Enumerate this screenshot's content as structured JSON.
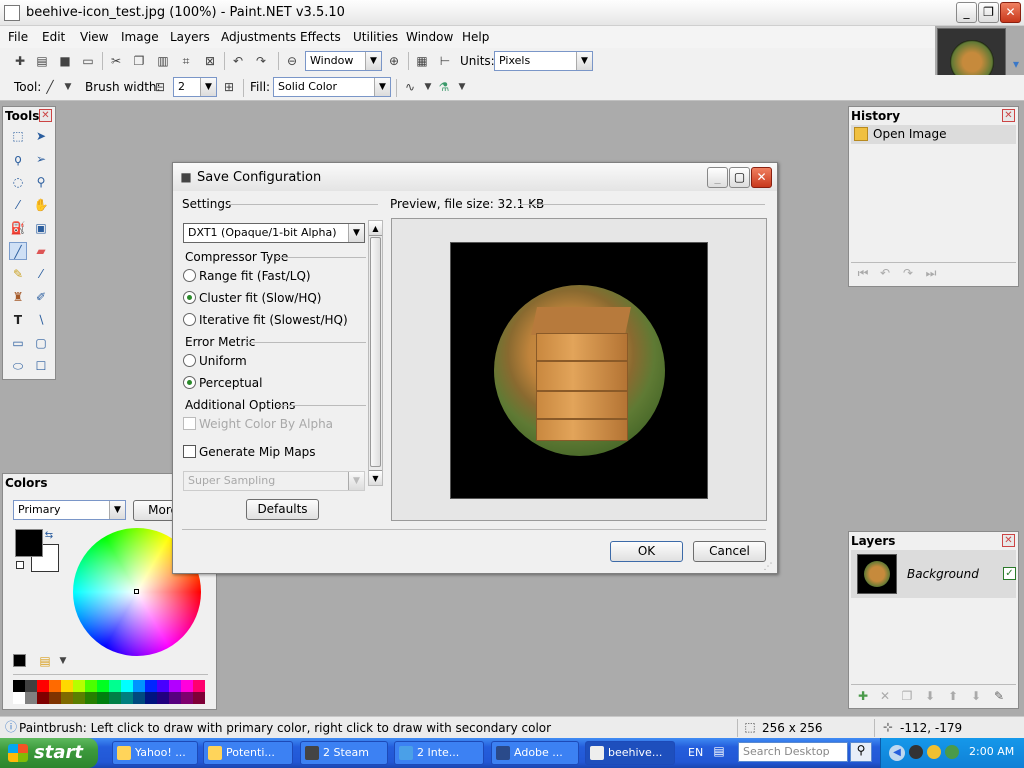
{
  "window": {
    "title": "beehive-icon_test.jpg (100%) - Paint.NET v3.5.10",
    "controls": [
      "_",
      "❐",
      "✕"
    ]
  },
  "menu": [
    "File",
    "Edit",
    "View",
    "Image",
    "Layers",
    "Adjustments",
    "Effects",
    "Utilities",
    "Window",
    "Help"
  ],
  "toolbar": {
    "zoom_value": "Window",
    "units_label": "Units:",
    "units_value": "Pixels",
    "tool_label": "Tool:",
    "brush_width_label": "Brush width:",
    "brush_width_value": "2",
    "fill_label": "Fill:",
    "fill_value": "Solid Color"
  },
  "tools_panel": {
    "title": "Tools"
  },
  "history_panel": {
    "title": "History",
    "items": [
      "Open Image"
    ]
  },
  "colors_panel": {
    "title": "Colors",
    "mode": "Primary",
    "more_label": "More",
    "palette": [
      "#000000",
      "#404040",
      "#ff0000",
      "#ff6a00",
      "#ffd800",
      "#b6ff00",
      "#4cff00",
      "#00ff21",
      "#00ff90",
      "#00ffff",
      "#0094ff",
      "#0026ff",
      "#4800ff",
      "#b200ff",
      "#ff00dc",
      "#ff006e",
      "#ffffff",
      "#808080",
      "#7f0000",
      "#7f3300",
      "#7f6a00",
      "#5b7f00",
      "#267f00",
      "#007f0e",
      "#007f46",
      "#007f7f",
      "#004a7f",
      "#00137f",
      "#21007f",
      "#57007f",
      "#7f006e",
      "#7f0037"
    ]
  },
  "layers_panel": {
    "title": "Layers",
    "layer_name": "Background"
  },
  "dialog": {
    "title": "Save Configuration",
    "settings_label": "Settings",
    "format_value": "DXT1 (Opaque/1-bit Alpha)",
    "compressor_type_label": "Compressor Type",
    "compressor_options": [
      "Range fit (Fast/LQ)",
      "Cluster fit (Slow/HQ)",
      "Iterative fit (Slowest/HQ)"
    ],
    "compressor_selected": 1,
    "error_metric_label": "Error Metric",
    "error_metric_options": [
      "Uniform",
      "Perceptual"
    ],
    "error_metric_selected": 1,
    "additional_options_label": "Additional Options",
    "weight_color_label": "Weight Color By Alpha",
    "mip_maps_label": "Generate Mip Maps",
    "sampling_value": "Super Sampling",
    "defaults_label": "Defaults",
    "preview_label": "Preview, file size: 32.1 KB",
    "ok_label": "OK",
    "cancel_label": "Cancel"
  },
  "statusbar": {
    "hint": "Paintbrush: Left click to draw with primary color, right click to draw with secondary color",
    "size": "256 x 256",
    "cursor": "-112, -179"
  },
  "taskbar": {
    "start_label": "start",
    "tasks": [
      "Yahoo! ...",
      "Potenti...",
      "2 Steam",
      "2 Inte...",
      "Adobe ...",
      "beehive..."
    ],
    "lang": "EN",
    "search_placeholder": "Search Desktop",
    "clock": "2:00 AM"
  }
}
